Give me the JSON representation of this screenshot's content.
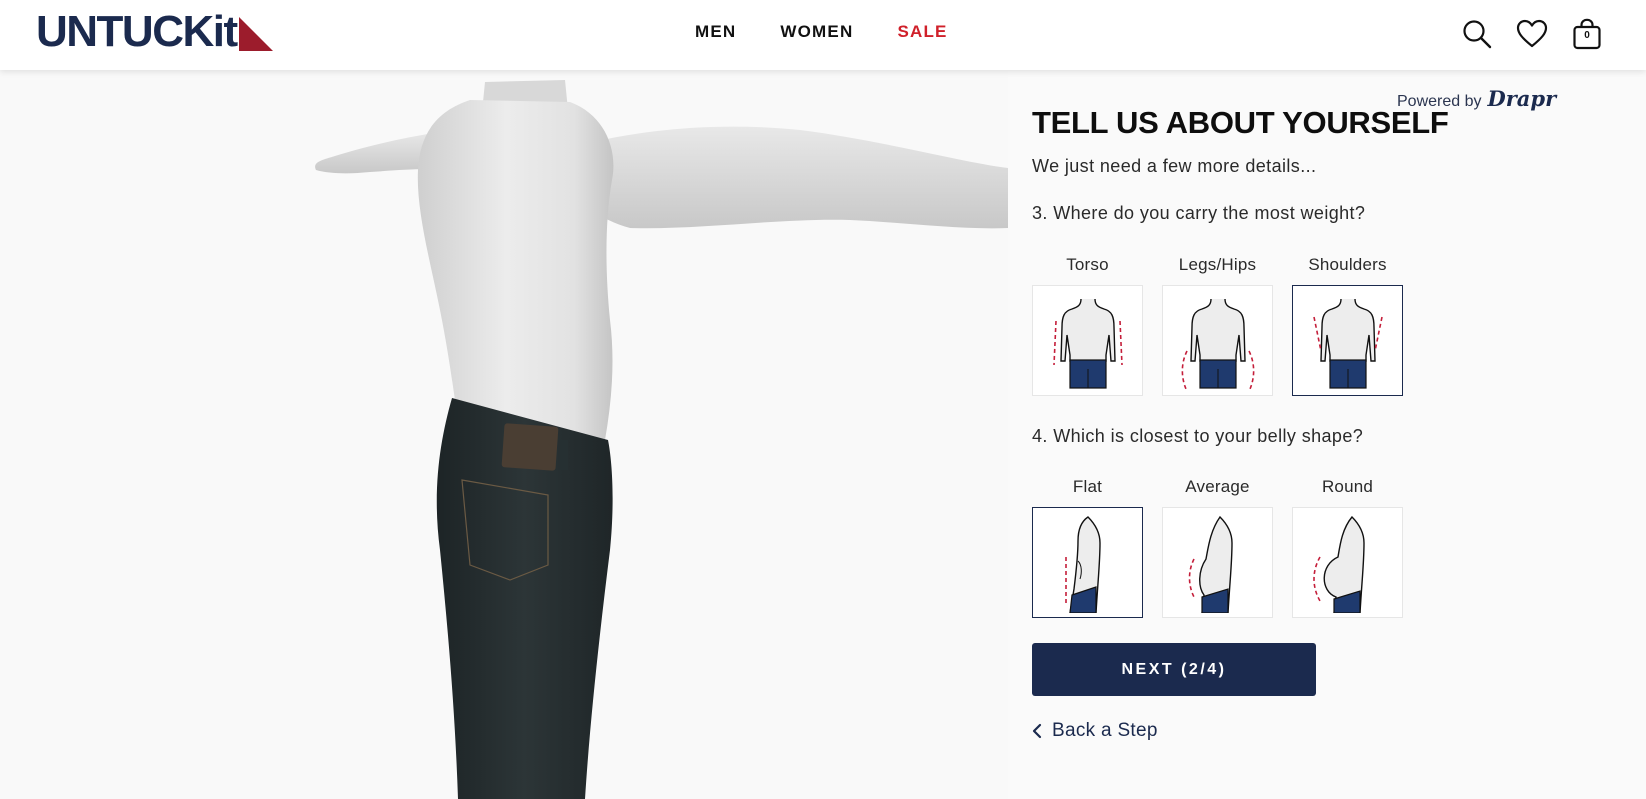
{
  "header": {
    "logo": {
      "text": "UNTUCKit",
      "accent_color": "#9c1c2c",
      "text_color": "#1b2a4e"
    },
    "nav": [
      {
        "label": "MEN"
      },
      {
        "label": "WOMEN"
      },
      {
        "label": "SALE",
        "color": "#d0202a"
      }
    ],
    "icons": [
      "search-icon",
      "heart-icon",
      "bag-icon"
    ],
    "cart_count": "0"
  },
  "panel": {
    "powered_by_prefix": "Powered by",
    "powered_by_brand": "Drapr",
    "title": "TELL US ABOUT YOURSELF",
    "subtitle": "We just need a few more details...",
    "question3": {
      "text": "3. Where do you carry the most weight?",
      "options": [
        {
          "label": "Torso",
          "selected": false
        },
        {
          "label": "Legs/Hips",
          "selected": false
        },
        {
          "label": "Shoulders",
          "selected": true
        }
      ]
    },
    "question4": {
      "text": "4. Which is closest to your belly shape?",
      "options": [
        {
          "label": "Flat",
          "selected": true
        },
        {
          "label": "Average",
          "selected": false
        },
        {
          "label": "Round",
          "selected": false
        }
      ]
    },
    "next_label": "NEXT (2/4)",
    "back_label": "Back a Step"
  },
  "colors": {
    "navy": "#1b2a4e",
    "sale_red": "#d0202a",
    "marker_red": "#c41e3a",
    "shorts_navy": "#1f3a6e"
  }
}
